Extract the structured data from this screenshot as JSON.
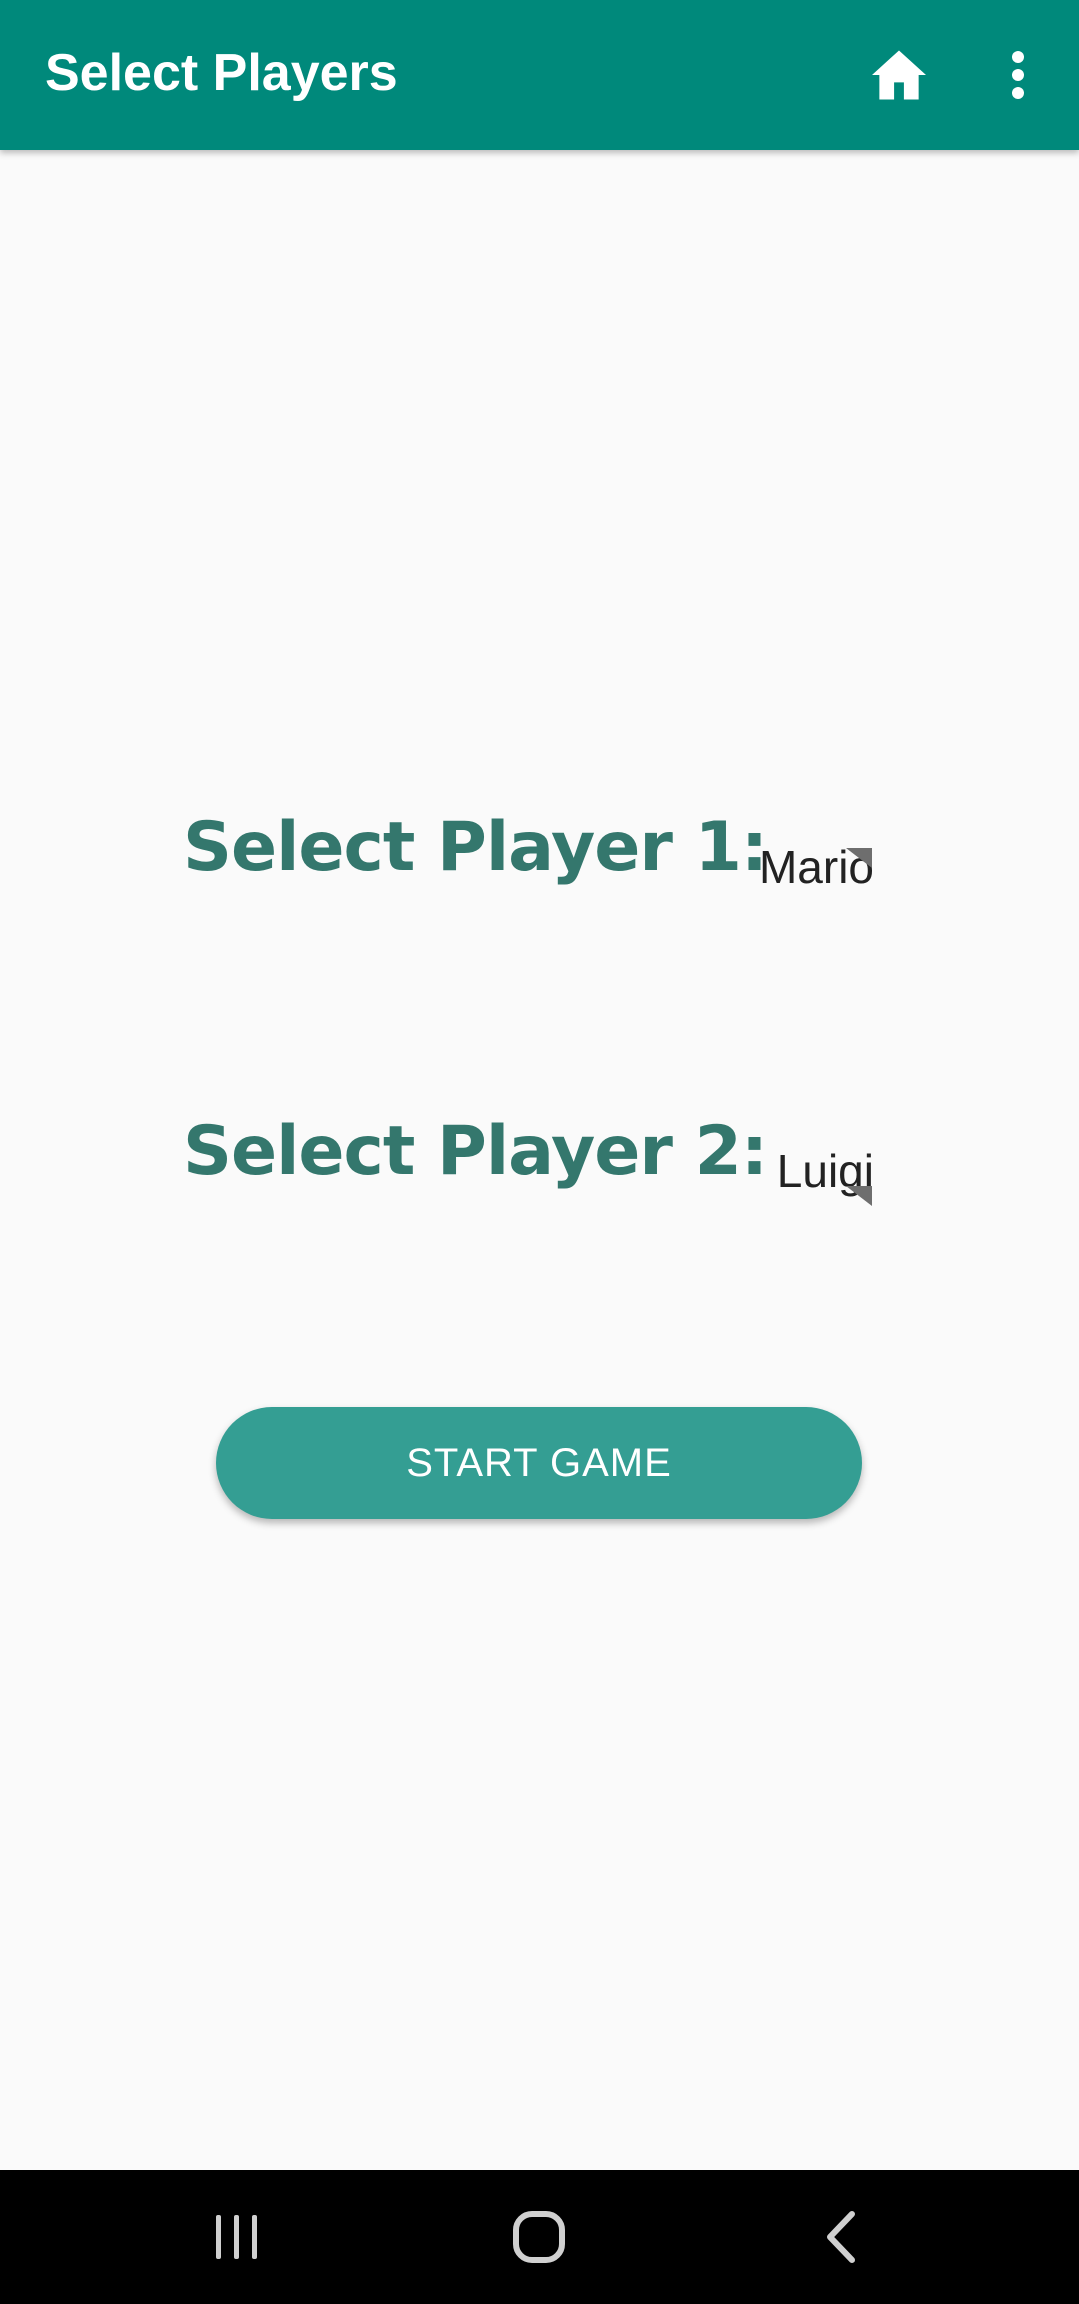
{
  "appbar": {
    "title": "Select Players",
    "home_icon": "home-icon",
    "menu_icon": "more-vert-icon",
    "color": "#00897b"
  },
  "players": [
    {
      "label": "Select Player 1:",
      "selected": "Mario"
    },
    {
      "label": "Select Player 2:",
      "selected": "Luigi"
    }
  ],
  "start_button": {
    "label": "START GAME",
    "color": "#349e93"
  },
  "navbar": {
    "recents_icon": "recents-icon",
    "home_icon": "nav-home-icon",
    "back_icon": "back-icon"
  },
  "colors": {
    "label_text": "#34776d",
    "background": "#fafafa"
  }
}
